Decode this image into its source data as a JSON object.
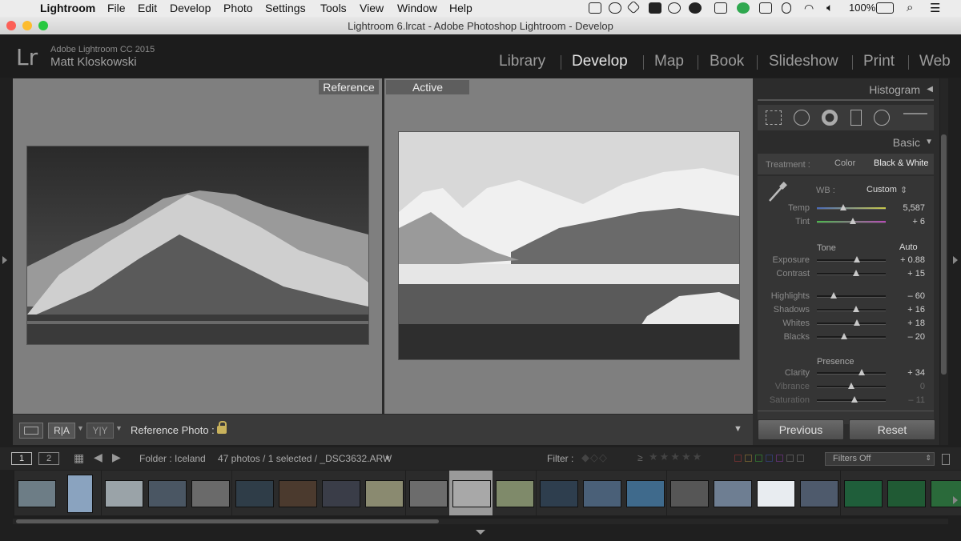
{
  "menubar": {
    "apple": "",
    "app": "Lightroom",
    "items": [
      "File",
      "Edit",
      "Develop",
      "Photo",
      "Settings",
      "Tools",
      "View",
      "Window",
      "Help"
    ],
    "battery": "100%",
    "icons": [
      "screen-record-icon",
      "vector-icon",
      "dropbox-icon",
      "evernote-icon",
      "info-icon",
      "creative-cloud-icon",
      "screen-share-icon",
      "grammarly-icon",
      "airplay-icon",
      "bluetooth-icon",
      "wifi-icon",
      "volume-icon",
      "battery-icon",
      "spotlight-icon",
      "menu-list-icon"
    ]
  },
  "window": {
    "title": "Lightroom 6.lrcat - Adobe Photoshop Lightroom - Develop"
  },
  "identity": {
    "logo": "Lr",
    "product": "Adobe Lightroom CC 2015",
    "user": "Matt Kloskowski"
  },
  "modules": [
    "Library",
    "Develop",
    "Map",
    "Book",
    "Slideshow",
    "Print",
    "Web"
  ],
  "active_module": "Develop",
  "view": {
    "reference_label": "Reference",
    "active_label": "Active"
  },
  "toolbar": {
    "ra": "R|A",
    "yy": "Y|Y",
    "reference_photo_label": "Reference Photo :"
  },
  "panel": {
    "histogram": "Histogram",
    "basic": "Basic",
    "treatment_label": "Treatment :",
    "treatment_color": "Color",
    "treatment_bw": "Black & White",
    "wb_label": "WB :",
    "wb_value": "Custom",
    "tone_label": "Tone",
    "auto_label": "Auto",
    "presence_label": "Presence",
    "sliders": [
      {
        "name": "Temp",
        "value": "5,587",
        "pos": 0.38
      },
      {
        "name": "Tint",
        "value": "+ 6",
        "pos": 0.52
      },
      {
        "name": "Exposure",
        "value": "+ 0.88",
        "pos": 0.58
      },
      {
        "name": "Contrast",
        "value": "+ 15",
        "pos": 0.57
      },
      {
        "name": "Highlights",
        "value": "– 60",
        "pos": 0.24
      },
      {
        "name": "Shadows",
        "value": "+ 16",
        "pos": 0.57
      },
      {
        "name": "Whites",
        "value": "+ 18",
        "pos": 0.58
      },
      {
        "name": "Blacks",
        "value": "– 20",
        "pos": 0.4
      },
      {
        "name": "Clarity",
        "value": "+ 34",
        "pos": 0.65
      },
      {
        "name": "Vibrance",
        "value": "0",
        "pos": 0.5
      },
      {
        "name": "Saturation",
        "value": "– 11",
        "pos": 0.55
      }
    ],
    "previous": "Previous",
    "reset": "Reset"
  },
  "filmstrip": {
    "view1": "1",
    "view2": "2",
    "folder": "Folder : Iceland",
    "count": "47 photos / 1 selected / _DSC3632.ARW",
    "filter_label": "Filter :",
    "filters_off": "Filters Off",
    "selected_index": 10,
    "thumb_colors": [
      "#6d7d86",
      "#8aa3bf",
      "#9aa3a8",
      "#4a5663",
      "#6a6a6a",
      "#2f3d48",
      "#4b3a2e",
      "#3a3d48",
      "#8a8a70",
      "#6c6c6c",
      "#a8a8a8",
      "#7f8a6a",
      "#2e3e4e",
      "#4a6078",
      "#3f6a8c",
      "#565656",
      "#6e7e92",
      "#e8ecf0",
      "#4e5a6c",
      "#1f5e3a",
      "#205a34",
      "#2a6a3a"
    ]
  }
}
